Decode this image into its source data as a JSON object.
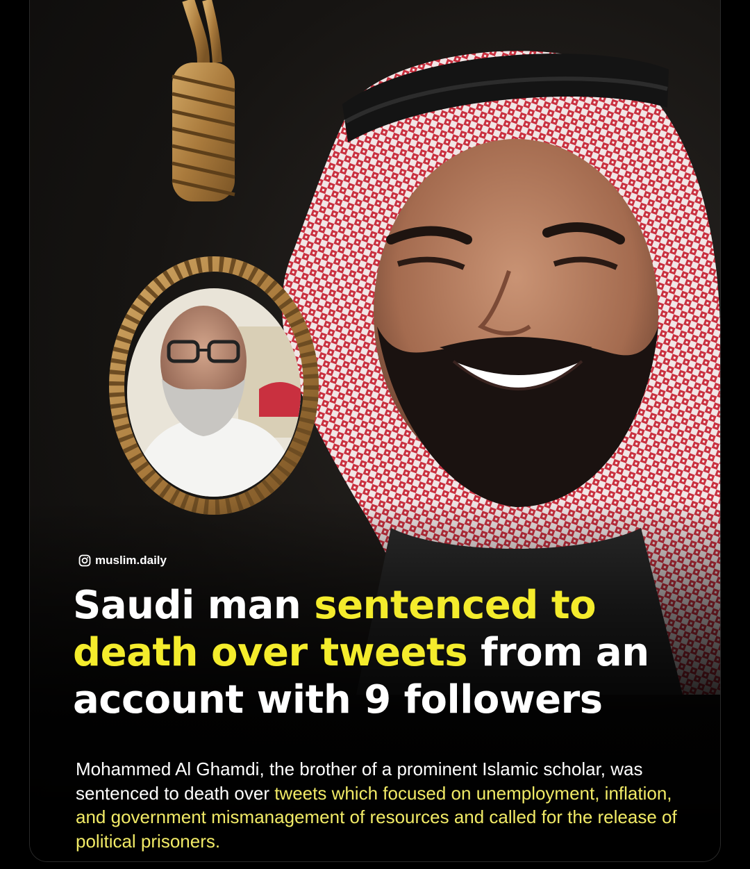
{
  "source": {
    "handle": "muslim.daily",
    "icon": "instagram-icon"
  },
  "headline": {
    "part1": "Saudi man ",
    "part2_highlight": "sentenced to death over tweets",
    "part3": " from an account with 9 followers"
  },
  "body": {
    "part1": "Mohammed Al Ghamdi, the brother of a prominent Islamic scholar, was sentenced to death over ",
    "part2_highlight": "tweets which focused on unemployment, inflation, and government mismanagement of resources and called for the release of political prisoners."
  },
  "colors": {
    "background": "#000000",
    "highlight_headline": "#f4ec2c",
    "highlight_body": "#f1ea66",
    "text": "#ffffff"
  }
}
